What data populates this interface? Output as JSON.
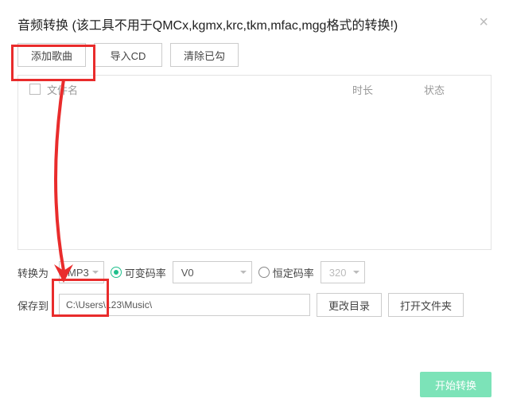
{
  "header": {
    "title": "音频转换 (该工具不用于QMCx,kgmx,krc,tkm,mfac,mgg格式的转换!)",
    "close_icon": "×"
  },
  "toolbar": {
    "add_label": "添加歌曲",
    "import_label": "导入CD",
    "clear_label": "清除已勾"
  },
  "list": {
    "col_name": "文件名",
    "col_duration": "时长",
    "col_status": "状态"
  },
  "convert": {
    "label": "转换为",
    "format": "MP3",
    "vbr_label": "可变码率",
    "vbr_value": "V0",
    "cbr_label": "恒定码率",
    "cbr_value": "320"
  },
  "save": {
    "label": "保存到",
    "path": "C:\\Users\\123\\Music\\",
    "change_dir": "更改目录",
    "open_dir": "打开文件夹"
  },
  "footer": {
    "start": "开始转换"
  }
}
